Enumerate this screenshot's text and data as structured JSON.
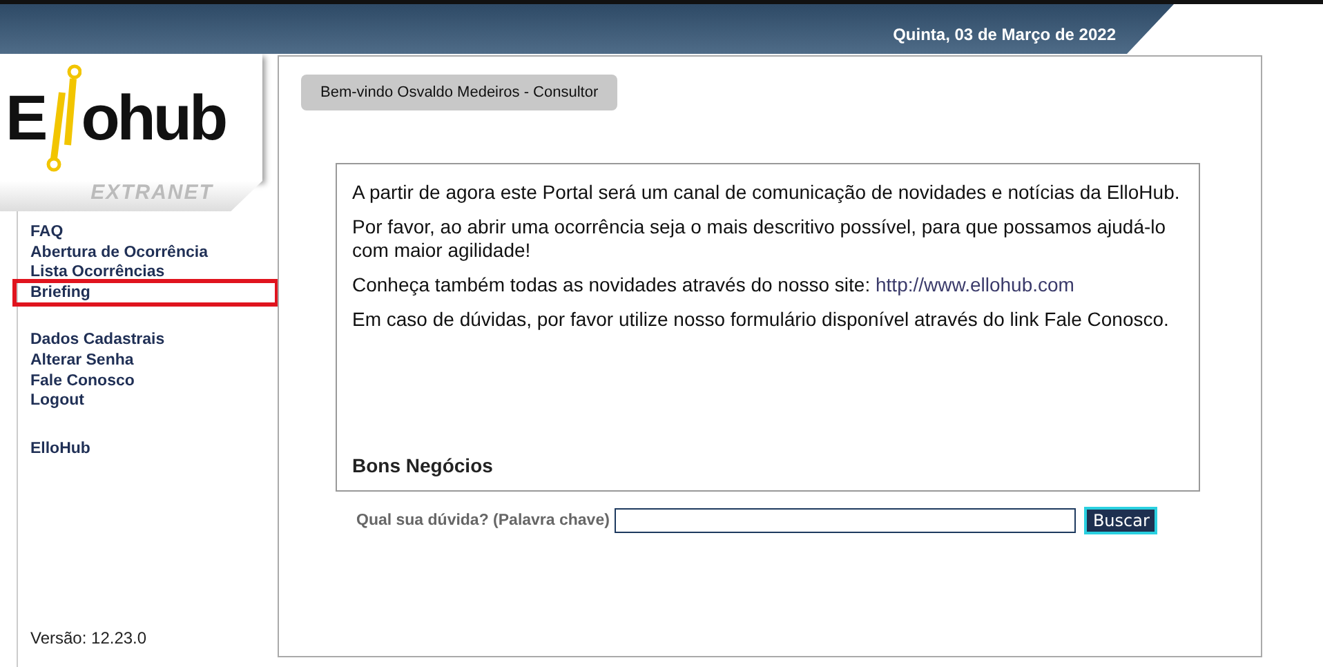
{
  "header": {
    "date": "Quinta, 03 de Março de 2022"
  },
  "logo": {
    "lead": "E",
    "rest": "ohub",
    "tagline": "EXTRANET"
  },
  "sidebar": {
    "groups": [
      [
        {
          "label": "FAQ",
          "highlighted": false
        },
        {
          "label": "Abertura de Ocorrência",
          "highlighted": false
        },
        {
          "label": "Lista Ocorrências",
          "highlighted": false
        },
        {
          "label": "Briefing",
          "highlighted": true
        }
      ],
      [
        {
          "label": "Dados Cadastrais",
          "highlighted": false
        },
        {
          "label": "Alterar Senha",
          "highlighted": false
        },
        {
          "label": "Fale Conosco",
          "highlighted": false
        },
        {
          "label": "Logout",
          "highlighted": false
        }
      ],
      [
        {
          "label": "ElloHub",
          "highlighted": false
        }
      ]
    ],
    "version": "Versão: 12.23.0"
  },
  "welcome_tab": "Bem-vindo Osvaldo Medeiros - Consultor",
  "message": {
    "paragraphs": [
      {
        "text": "A partir de agora este Portal será um canal de comunicação de novidades e notícias da ElloHub."
      },
      {
        "text": "Por favor, ao abrir uma ocorrência seja o mais descritivo possível, para que possamos ajudá-lo com maior agilidade!"
      },
      {
        "text": "Conheça também todas as novidades através do nosso site:",
        "link": "http://www.ellohub.com"
      },
      {
        "text": "Em caso de dúvidas, por favor utilize nosso formulário disponível através do link Fale Conosco."
      }
    ],
    "closing": "Bons Negócios"
  },
  "search": {
    "label": "Qual sua dúvida? (Palavra chave)",
    "button": "Buscar"
  }
}
